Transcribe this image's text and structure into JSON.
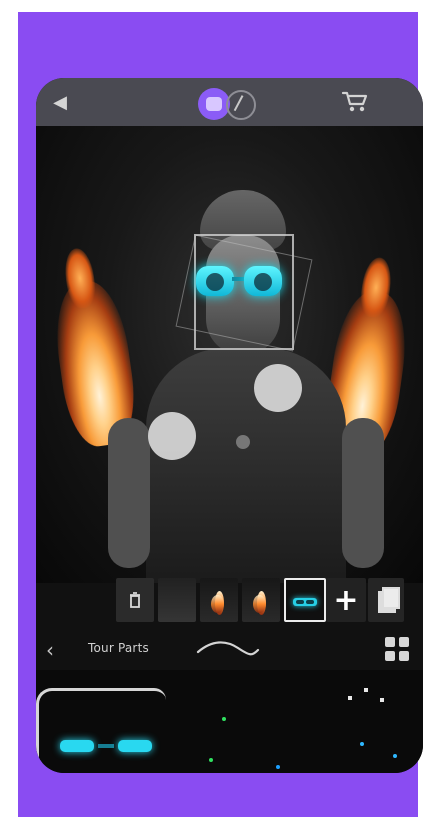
{
  "screen": {
    "background_color": "#8a4cf2",
    "phone_background": "#111111"
  },
  "top_bar": {
    "left_icon": "back-speaker-icon",
    "center_icon_primary": "editor-logo-icon",
    "center_icon_secondary": "brush-icon",
    "right_icon": "cart-icon"
  },
  "editor": {
    "effect_labels": [],
    "fire_color": "#f89b39",
    "glasses_color": "#29d8f0"
  },
  "toolbar": {
    "thumbnail_items": [
      {
        "type": "trash-icon"
      },
      {
        "type": "body-thumb"
      },
      {
        "type": "fire-thumb"
      },
      {
        "type": "fire-thumb"
      },
      {
        "type": "glasses-thumb",
        "selected": true
      },
      {
        "type": "add-icon"
      },
      {
        "type": "duplicate-icon"
      }
    ]
  },
  "bottom_nav": {
    "title": "Tour Parts",
    "left_icon": "chevron-left-icon",
    "right_icon": "grid-icon"
  }
}
